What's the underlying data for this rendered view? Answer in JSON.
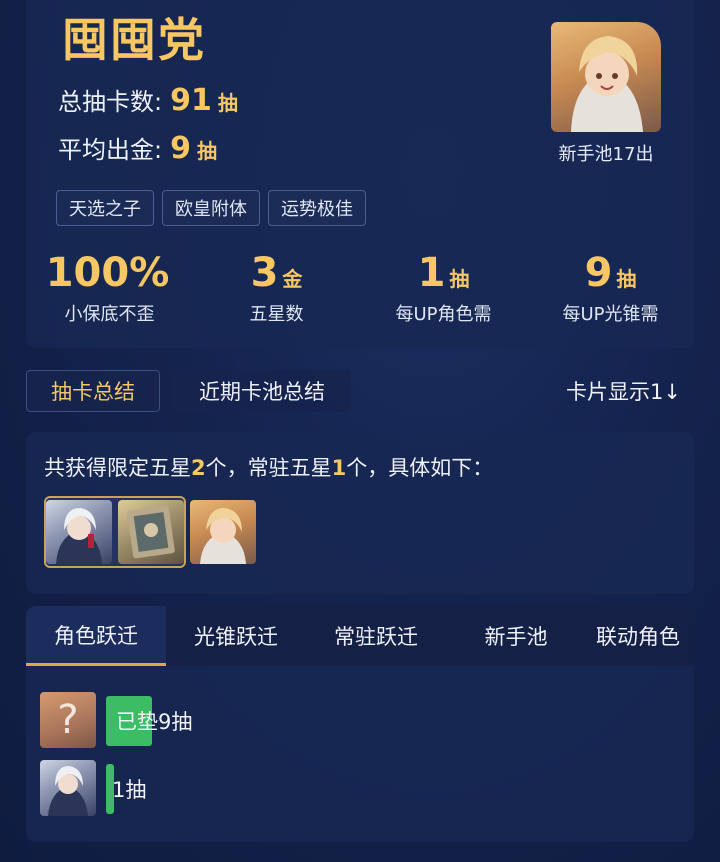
{
  "summary": {
    "title": "囤囤党",
    "total_label": "总抽卡数:",
    "total_value": "91",
    "total_unit": "抽",
    "avg_label": "平均出金:",
    "avg_value": "9",
    "avg_unit": "抽",
    "tags": [
      "天选之子",
      "欧皇附体",
      "运势极佳"
    ],
    "avatar_caption": "新手池17出",
    "stats": [
      {
        "value": "100%",
        "unit": "",
        "label": "小保底不歪"
      },
      {
        "value": "3",
        "unit": "金",
        "label": "五星数"
      },
      {
        "value": "1",
        "unit": "抽",
        "label": "每UP角色需"
      },
      {
        "value": "9",
        "unit": "抽",
        "label": "每UP光锥需"
      }
    ]
  },
  "tabs": {
    "summary": "抽卡总结",
    "recent": "近期卡池总结",
    "card_display": "卡片显示1↓"
  },
  "fivestar": {
    "prefix": "共获得限定五星",
    "limited": "2",
    "middle": "个，常驻五星",
    "standard": "1",
    "suffix": "个，具体如下："
  },
  "pool_tabs": [
    "角色跃迁",
    "光锥跃迁",
    "常驻跃迁",
    "新手池",
    "联动角色"
  ],
  "pool_rows": [
    {
      "avatar_glyph": "?",
      "text": "已垫9抽"
    },
    {
      "avatar_glyph": "",
      "text": "1抽"
    }
  ],
  "colors": {
    "accent": "#f6c763",
    "progress": "#3bbd63",
    "tab_underline": "#e0a640"
  }
}
